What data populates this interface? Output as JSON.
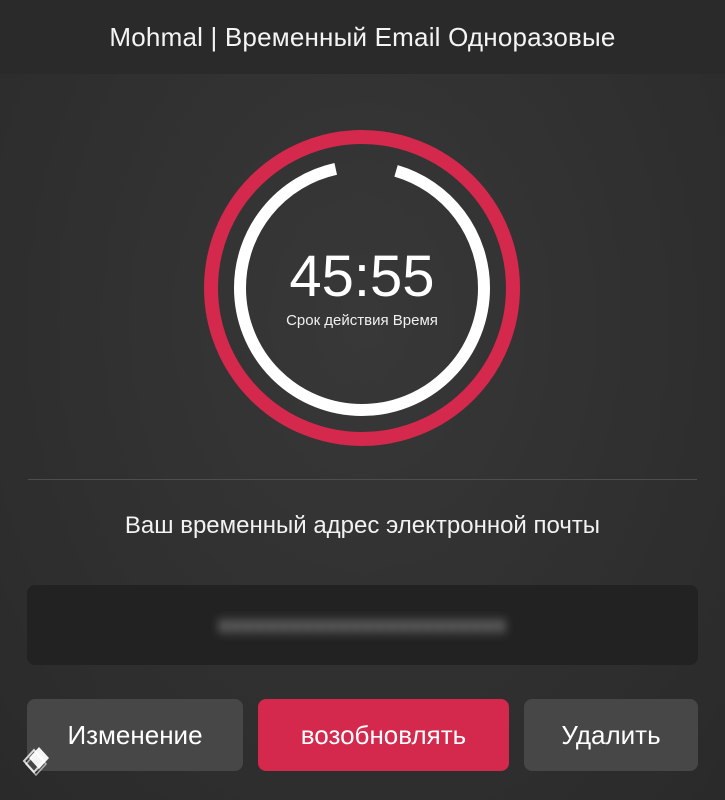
{
  "header": {
    "title": "Mohmal | Временный Email Одноразовые"
  },
  "timer": {
    "value": "45:55",
    "label": "Срок действия Время",
    "remaining_fraction": 0.92,
    "ring_color": "#d4284c",
    "progress_color": "#ffffff"
  },
  "email": {
    "heading": "Ваш временный адрес электронной почты",
    "address": "xxxxxxxxxxxxxxxxxxxxxxxx"
  },
  "actions": {
    "change_label": "Изменение",
    "renew_label": "возобновлять",
    "delete_label": "Удалить"
  },
  "colors": {
    "accent": "#d4284c",
    "background": "#303030",
    "button_secondary": "#474747",
    "email_box": "#222222"
  },
  "icons": {
    "corner_logo": "layers-logo-icon"
  }
}
